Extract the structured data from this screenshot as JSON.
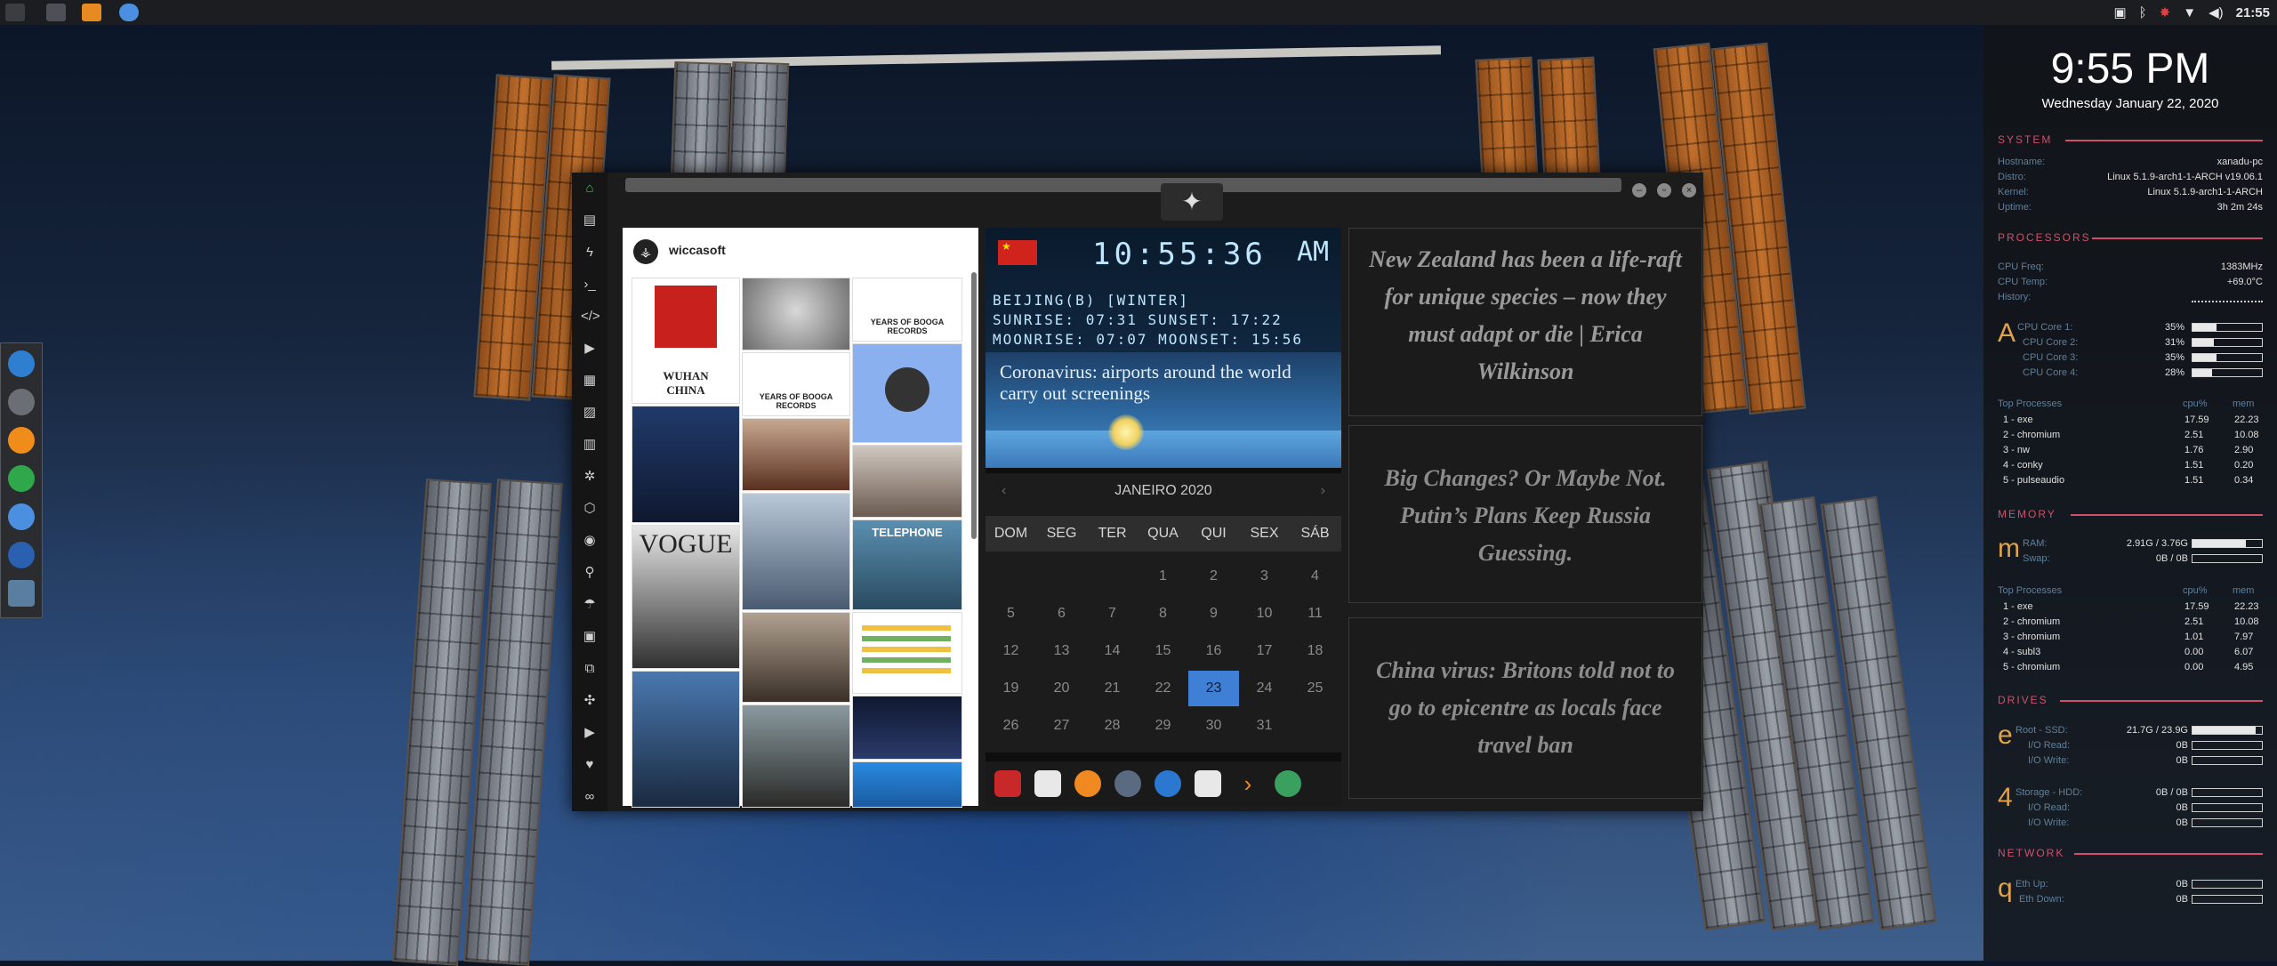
{
  "topbar": {
    "clock": "21:55",
    "tray_icons": [
      "screenshot-icon",
      "bluetooth-icon",
      "alert-icon",
      "wifi-icon",
      "volume-icon",
      "power-icon"
    ]
  },
  "window": {
    "emblem_icon": "rebel-alliance-icon",
    "sidebar_icons": [
      "home-icon",
      "document-icon",
      "lightning-icon",
      "terminal-icon",
      "code-icon",
      "play-icon",
      "sticker-icon",
      "image-icon",
      "newspaper-icon",
      "settings-cog-icon",
      "hexagon-icon",
      "globe-icon",
      "search-icon",
      "umbrella-icon",
      "portrait-icon",
      "tags-icon",
      "expand-icon",
      "youtube-icon",
      "heart-icon",
      "link-icon"
    ]
  },
  "instagram": {
    "username": "wiccasoft",
    "tiles": [
      {
        "caption": "WUHAN\nCHINA"
      },
      {
        "caption": ""
      },
      {
        "caption": "YEARS OF BOOGA RECORDS"
      },
      {
        "caption": "YEARS OF BOOGA RECORDS"
      },
      {
        "caption": ""
      },
      {
        "caption": ""
      },
      {
        "caption": ""
      },
      {
        "caption": ""
      },
      {
        "caption": "TELEPHONE"
      },
      {
        "caption": "VOGUE"
      },
      {
        "caption": ""
      },
      {
        "caption": ""
      },
      {
        "caption": ""
      },
      {
        "caption": ""
      },
      {
        "caption": ""
      }
    ]
  },
  "clock_widget": {
    "time": "10:55:36",
    "ampm": "AM",
    "location": "BEIJING(B) [WINTER]",
    "sun": "SUNRISE: 07:31 SUNSET: 17:22",
    "moon": "MOONRISE: 07:07 MOONSET: 15:56",
    "headline": "Coronavirus: airports around the world carry out screenings"
  },
  "calendar": {
    "month": "JANEIRO 2020",
    "dows": [
      "DOM",
      "SEG",
      "TER",
      "QUA",
      "QUI",
      "SEX",
      "SÁB"
    ],
    "weeks": [
      [
        "",
        "",
        "",
        "1",
        "2",
        "3",
        "4"
      ],
      [
        "5",
        "6",
        "7",
        "8",
        "9",
        "10",
        "11"
      ],
      [
        "12",
        "13",
        "14",
        "15",
        "16",
        "17",
        "18"
      ],
      [
        "19",
        "20",
        "21",
        "22",
        "23",
        "24",
        "25"
      ],
      [
        "26",
        "27",
        "28",
        "29",
        "30",
        "31",
        ""
      ]
    ],
    "today": "23"
  },
  "launcher": [
    "triangle-alert-icon",
    "calendar-app-icon",
    "search-app-icon",
    "clock-app-icon",
    "globe-app-icon",
    "date-app-icon",
    "arrow-app-icon",
    "yandex-icon"
  ],
  "news_cards": [
    "New Zealand has been a life-raft for unique species – now they must adapt or die | Erica Wilkinson",
    "Big Changes? Or Maybe Not. Putin’s Plans Keep Russia Guessing.",
    "China virus: Britons told not to go to epicentre as locals face travel ban"
  ],
  "conky": {
    "time": "9:55 PM",
    "date": "Wednesday January 22, 2020",
    "system_title": "SYSTEM",
    "system": [
      {
        "k": "Hostname:",
        "v": "xanadu-pc"
      },
      {
        "k": "Distro:",
        "v": "Linux 5.1.9-arch1-1-ARCH v19.06.1"
      },
      {
        "k": "Kernel:",
        "v": "Linux 5.1.9-arch1-1-ARCH"
      },
      {
        "k": "Uptime:",
        "v": "3h 2m 24s"
      }
    ],
    "processors_title": "PROCESSORS",
    "cpu_info": [
      {
        "k": "CPU Freq:",
        "v": "1383MHz"
      },
      {
        "k": "CPU Temp:",
        "v": "+69.0°C"
      },
      {
        "k": "History:",
        "v": ""
      }
    ],
    "cpu_glyph": "A",
    "cores": [
      {
        "k": "CPU Core 1:",
        "p": "35%",
        "f": 0.35
      },
      {
        "k": "CPU Core 2:",
        "p": "31%",
        "f": 0.31
      },
      {
        "k": "CPU Core 3:",
        "p": "35%",
        "f": 0.35
      },
      {
        "k": "CPU Core 4:",
        "p": "28%",
        "f": 0.28
      }
    ],
    "top_proc_title": "Top Processes",
    "col_cpu": "cpu%",
    "col_mem": "mem",
    "cpu_procs": [
      {
        "n": "1 - exe",
        "c": "17.59",
        "m": "22.23"
      },
      {
        "n": "2 - chromium",
        "c": "2.51",
        "m": "10.08"
      },
      {
        "n": "3 - nw",
        "c": "1.76",
        "m": "2.90"
      },
      {
        "n": "4 - conky",
        "c": "1.51",
        "m": "0.20"
      },
      {
        "n": "5 - pulseaudio",
        "c": "1.51",
        "m": "0.34"
      }
    ],
    "memory_title": "MEMORY",
    "mem_glyph": "m",
    "ram": {
      "k": "RAM:",
      "v": "2.91G / 3.76G",
      "f": 0.77
    },
    "swap": {
      "k": "Swap:",
      "v": "0B / 0B",
      "f": 0
    },
    "mem_procs": [
      {
        "n": "1 - exe",
        "c": "17.59",
        "m": "22.23"
      },
      {
        "n": "2 - chromium",
        "c": "2.51",
        "m": "10.08"
      },
      {
        "n": "3 - chromium",
        "c": "1.01",
        "m": "7.97"
      },
      {
        "n": "4 - subl3",
        "c": "0.00",
        "m": "6.07"
      },
      {
        "n": "5 - chromium",
        "c": "0.00",
        "m": "4.95"
      }
    ],
    "drives_title": "DRIVES",
    "drive_glyph_1": "e",
    "drive_glyph_2": "4",
    "root": {
      "k": "Root - SSD:",
      "v": "21.7G / 23.9G",
      "f": 0.91
    },
    "root_read": {
      "k": "I/O Read:",
      "v": "0B"
    },
    "root_write": {
      "k": "I/O Write:",
      "v": "0B"
    },
    "storage": {
      "k": "Storage - HDD:",
      "v": "0B / 0B",
      "f": 0
    },
    "storage_read": {
      "k": "I/O Read:",
      "v": "0B"
    },
    "storage_write": {
      "k": "I/O Write:",
      "v": "0B"
    },
    "network_title": "NETWORK",
    "net_glyph": "q",
    "eth_up": {
      "k": "Eth Up:",
      "v": "0B"
    },
    "eth_down": {
      "k": "Eth Down:",
      "v": "0B"
    }
  },
  "colors": {
    "accent": "#d0506a",
    "today": "#3f7fd6"
  }
}
